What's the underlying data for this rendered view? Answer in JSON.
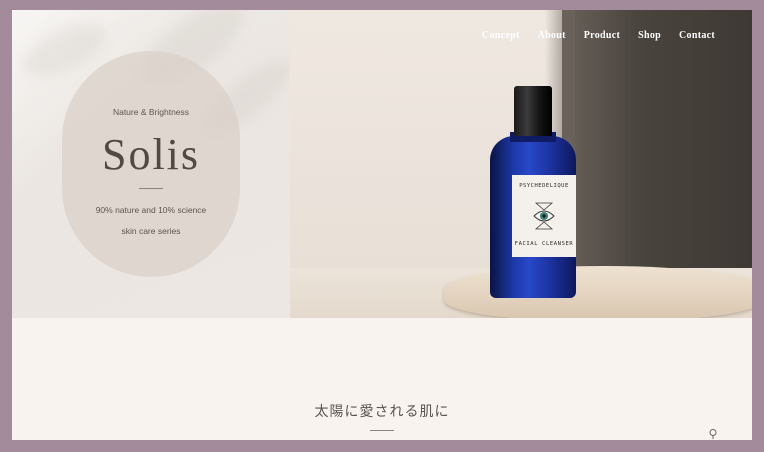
{
  "nav": {
    "items": [
      {
        "label": "Concept"
      },
      {
        "label": "About"
      },
      {
        "label": "Product"
      },
      {
        "label": "Shop"
      },
      {
        "label": "Contact"
      }
    ]
  },
  "hero": {
    "tagline": "Nature & Brightness",
    "brand": "Solis",
    "description_line1": "90% nature and 10%  science",
    "description_line2": "skin care series",
    "bottle_label_top": "PSYCHEDELIQUE",
    "bottle_label_bottom": "FACIAL CLEANSER"
  },
  "section": {
    "title": "太陽に愛される肌に"
  },
  "icons": {
    "scroll": "search-icon"
  }
}
